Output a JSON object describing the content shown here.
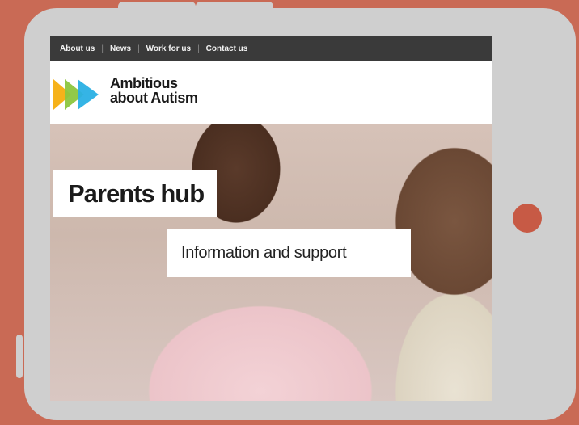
{
  "nav": {
    "items": [
      {
        "label": "About us"
      },
      {
        "label": "News"
      },
      {
        "label": "Work for us"
      },
      {
        "label": "Contact us"
      }
    ],
    "separator": "|"
  },
  "brand": {
    "line1": "Ambitious",
    "line2": "about Autism",
    "colors": [
      "#f6b21a",
      "#8cc63f",
      "#2ab0e4"
    ]
  },
  "hero": {
    "title": "Parents hub",
    "subtitle": "Information and support"
  },
  "device": {
    "frame_color": "#cfcfcf",
    "home_button_color": "#c75a45",
    "background": "#c96a55"
  }
}
